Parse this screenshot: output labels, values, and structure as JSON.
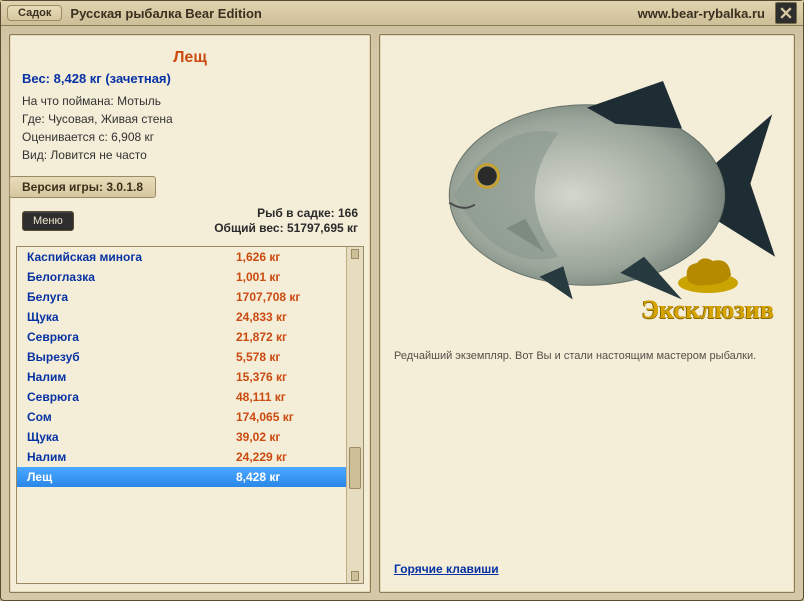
{
  "titlebar": {
    "tab": "Садок",
    "title": "Русская рыбалка Bear Edition",
    "url": "www.bear-rybalka.ru"
  },
  "details": {
    "name": "Лещ",
    "weight_label": "Вес:",
    "weight_value": "8,428 кг",
    "weight_qualifier": "(зачетная)",
    "bait_label": "На что поймана:",
    "bait_value": "Мотыль",
    "where_label": "Где:",
    "where_value": "Чусовая, Живая стена",
    "valued_label": "Оценивается с:",
    "valued_value": "6,908 кг",
    "kind_label": "Вид:",
    "kind_value": "Ловится не часто"
  },
  "version": {
    "label": "Версия игры:",
    "value": "3.0.1.8"
  },
  "menu": {
    "button": "Меню",
    "count_label": "Рыб в садке:",
    "count_value": "166",
    "total_label": "Общий вес:",
    "total_value": "51797,695 кг"
  },
  "list": [
    {
      "name": "Каспийская минога",
      "weight": "1,626 кг",
      "selected": false
    },
    {
      "name": "Белоглазка",
      "weight": "1,001 кг",
      "selected": false
    },
    {
      "name": "Белуга",
      "weight": "1707,708 кг",
      "selected": false
    },
    {
      "name": "Щука",
      "weight": "24,833 кг",
      "selected": false
    },
    {
      "name": "Севрюга",
      "weight": "21,872 кг",
      "selected": false
    },
    {
      "name": "Вырезуб",
      "weight": "5,578 кг",
      "selected": false
    },
    {
      "name": "Налим",
      "weight": "15,376 кг",
      "selected": false
    },
    {
      "name": "Севрюга",
      "weight": "48,111 кг",
      "selected": false
    },
    {
      "name": "Сом",
      "weight": "174,065 кг",
      "selected": false
    },
    {
      "name": "Щука",
      "weight": "39,02 кг",
      "selected": false
    },
    {
      "name": "Налим",
      "weight": "24,229 кг",
      "selected": false
    },
    {
      "name": "Лещ",
      "weight": "8,428 кг",
      "selected": true
    }
  ],
  "right": {
    "badge_text": "Эксклюзив",
    "description": "Редчайший экземпляр. Вот Вы и стали настоящим мастером рыбалки.",
    "hotkeys": "Горячие клавиши"
  }
}
